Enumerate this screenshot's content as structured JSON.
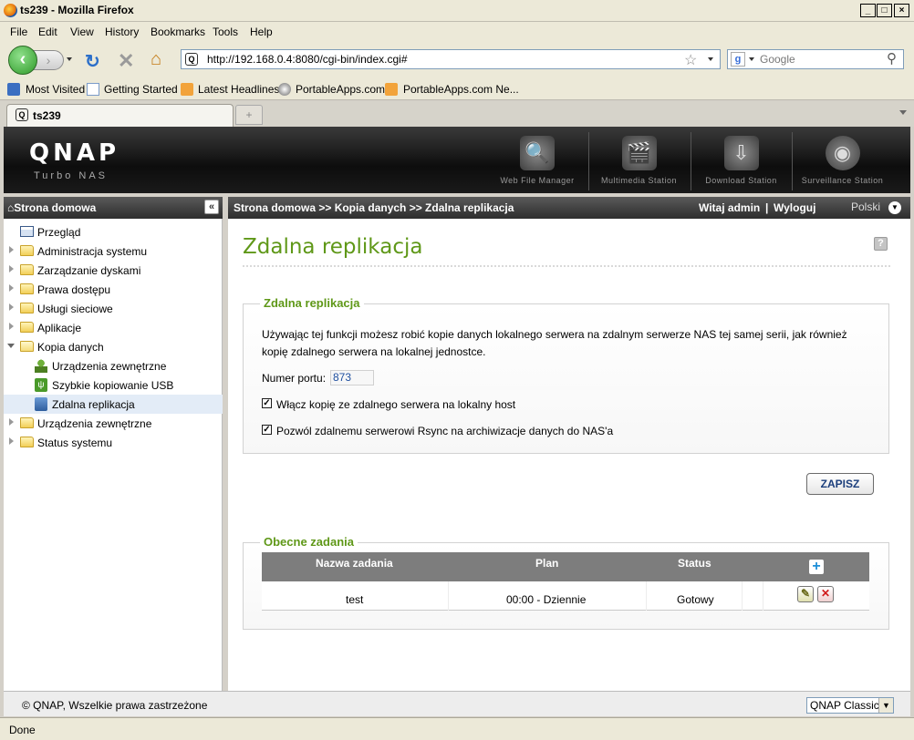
{
  "window": {
    "title": "ts239 - Mozilla Firefox"
  },
  "menu": [
    "File",
    "Edit",
    "View",
    "History",
    "Bookmarks",
    "Tools",
    "Help"
  ],
  "nav": {
    "url": "http://192.168.0.4:8080/cgi-bin/index.cgi#",
    "search_placeholder": "Google"
  },
  "bookmarks": [
    "Most Visited",
    "Getting Started",
    "Latest Headlines",
    "PortableApps.com",
    "PortableApps.com Ne..."
  ],
  "tab": {
    "title": "ts239"
  },
  "brand": {
    "logo": "QNAP",
    "subtitle": "Turbo NAS"
  },
  "apps": [
    "Web File Manager",
    "Multimedia Station",
    "Download Station",
    "Surveillance Station"
  ],
  "sidebar": {
    "title": "Strona domowa",
    "items": [
      {
        "label": "Przegląd"
      },
      {
        "label": "Administracja systemu"
      },
      {
        "label": "Zarządzanie dyskami"
      },
      {
        "label": "Prawa dostępu"
      },
      {
        "label": "Usługi sieciowe"
      },
      {
        "label": "Aplikacje"
      },
      {
        "label": "Kopia danych"
      },
      {
        "label": "Urządzenia zewnętrzne"
      },
      {
        "label": "Szybkie kopiowanie USB"
      },
      {
        "label": "Zdalna replikacja"
      },
      {
        "label": "Urządzenia zewnętrzne"
      },
      {
        "label": "Status systemu"
      }
    ]
  },
  "header": {
    "breadcrumb": "Strona domowa >> Kopia danych >> Zdalna replikacja",
    "welcome": "Witaj admin",
    "separator": "|",
    "logout": "Wyloguj",
    "language": "Polski"
  },
  "page": {
    "title": "Zdalna replikacja",
    "section1": {
      "legend": "Zdalna replikacja",
      "description": "Używając tej funkcji możesz robić kopie danych lokalnego serwera na zdalnym serwerze NAS tej samej serii, jak również kopię zdalnego serwera na lokalnej jednostce.",
      "port_label": "Numer portu:",
      "port_value": "873",
      "checkbox1": "Włącz kopię ze zdalnego serwera na lokalny host",
      "checkbox2": "Pozwól zdalnemu serwerowi Rsync na archiwizacje danych do NAS'a"
    },
    "save_label": "ZAPISZ",
    "section2": {
      "legend": "Obecne zadania",
      "columns": [
        "Nazwa zadania",
        "Plan",
        "Status"
      ],
      "rows": [
        {
          "name": "test",
          "plan": "00:00 - Dziennie",
          "status": "Gotowy"
        }
      ]
    }
  },
  "footer": {
    "copyright": "© QNAP, Wszelkie prawa zastrzeżone",
    "theme": "QNAP Classic"
  },
  "status": "Done"
}
